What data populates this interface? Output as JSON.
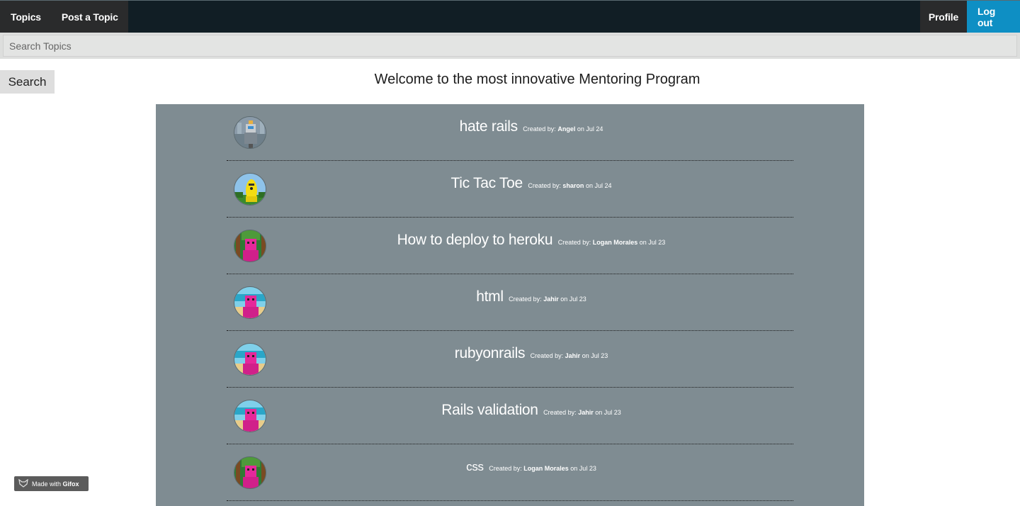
{
  "nav": {
    "topics_label": "Topics",
    "post_label": "Post a Topic",
    "profile_label": "Profile",
    "logout_label": "Log out"
  },
  "search": {
    "placeholder": "Search Topics",
    "button_label": "Search"
  },
  "welcome_text": "Welcome to the most innovative Mentoring Program",
  "topics": [
    {
      "title": "hate rails",
      "created_by_label": "Created by:",
      "author": "Angel",
      "date_text": "on Jul 24",
      "avatar": "robot-avatar"
    },
    {
      "title": "Tic Tac Toe",
      "created_by_label": "Created by:",
      "author": "sharon",
      "date_text": "on Jul 24",
      "avatar": "banana-avatar"
    },
    {
      "title": "How to deploy to heroku",
      "created_by_label": "Created by:",
      "author": "Logan Morales",
      "date_text": "on Jul 23",
      "avatar": "pink-figure-forest-avatar"
    },
    {
      "title": "html",
      "created_by_label": "Created by:",
      "author": "Jahir",
      "date_text": "on Jul 23",
      "avatar": "pink-figure-beach-avatar"
    },
    {
      "title": "rubyonrails",
      "created_by_label": "Created by:",
      "author": "Jahir",
      "date_text": "on Jul 23",
      "avatar": "pink-figure-beach-avatar"
    },
    {
      "title": "Rails validation",
      "created_by_label": "Created by:",
      "author": "Jahir",
      "date_text": "on Jul 23",
      "avatar": "pink-figure-beach-avatar"
    },
    {
      "title": "css",
      "created_by_label": "Created by:",
      "author": "Logan Morales",
      "date_text": "on Jul 23",
      "avatar": "pink-figure-forest-avatar"
    }
  ],
  "badge": {
    "prefix": "Made with",
    "brand": "Gifox",
    "icon": "fox-icon"
  },
  "colors": {
    "navbar": "#111e25",
    "logout": "#0e8fc4",
    "panel": "#7f8c92"
  }
}
